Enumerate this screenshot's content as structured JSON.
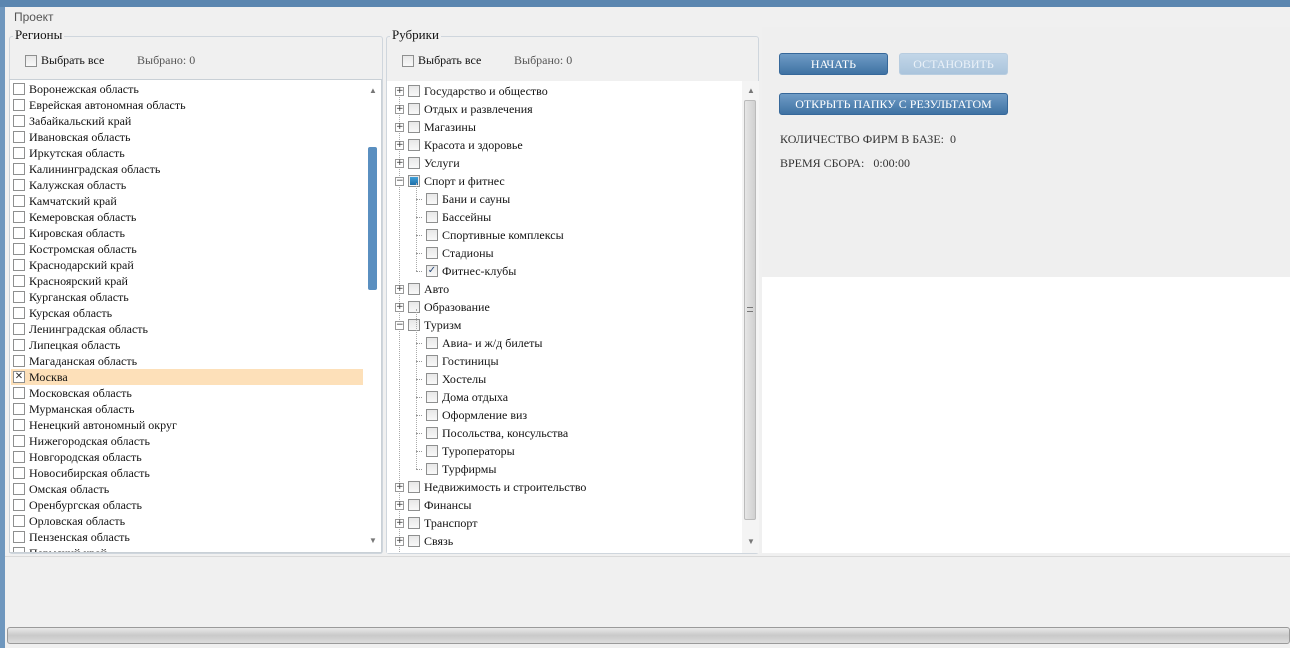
{
  "menu": {
    "project": "Проект"
  },
  "regions": {
    "title": "Регионы",
    "select_all": "Выбрать все",
    "selected": "Выбрано: 0",
    "items": [
      {
        "label": "Воронежская область",
        "checked": false
      },
      {
        "label": "Еврейская автономная область",
        "checked": false
      },
      {
        "label": "Забайкальский край",
        "checked": false
      },
      {
        "label": "Ивановская область",
        "checked": false
      },
      {
        "label": "Иркутская область",
        "checked": false
      },
      {
        "label": "Калининградская область",
        "checked": false
      },
      {
        "label": "Калужская область",
        "checked": false
      },
      {
        "label": "Камчатский край",
        "checked": false
      },
      {
        "label": "Кемеровская область",
        "checked": false
      },
      {
        "label": "Кировская область",
        "checked": false
      },
      {
        "label": "Костромская область",
        "checked": false
      },
      {
        "label": "Краснодарский край",
        "checked": false
      },
      {
        "label": "Красноярский край",
        "checked": false
      },
      {
        "label": "Курганская область",
        "checked": false
      },
      {
        "label": "Курская область",
        "checked": false
      },
      {
        "label": "Ленинградская область",
        "checked": false
      },
      {
        "label": "Липецкая область",
        "checked": false
      },
      {
        "label": "Магаданская область",
        "checked": false
      },
      {
        "label": "Москва",
        "checked": true,
        "selected": true
      },
      {
        "label": "Московская область",
        "checked": false
      },
      {
        "label": "Мурманская область",
        "checked": false
      },
      {
        "label": "Ненецкий автономный округ",
        "checked": false
      },
      {
        "label": "Нижегородская область",
        "checked": false
      },
      {
        "label": "Новгородская область",
        "checked": false
      },
      {
        "label": "Новосибирская область",
        "checked": false
      },
      {
        "label": "Омская область",
        "checked": false
      },
      {
        "label": "Оренбургская область",
        "checked": false
      },
      {
        "label": "Орловская область",
        "checked": false
      },
      {
        "label": "Пензенская область",
        "checked": false
      },
      {
        "label": "Пермский край",
        "checked": false
      }
    ]
  },
  "rubrics": {
    "title": "Рубрики",
    "select_all": "Выбрать все",
    "selected": "Выбрано: 0",
    "items": [
      {
        "label": "Государство и общество",
        "level": 0,
        "expand": "+",
        "state": "none"
      },
      {
        "label": "Отдых и развлечения",
        "level": 0,
        "expand": "+",
        "state": "none"
      },
      {
        "label": "Магазины",
        "level": 0,
        "expand": "+",
        "state": "none"
      },
      {
        "label": "Красота и здоровье",
        "level": 0,
        "expand": "+",
        "state": "none"
      },
      {
        "label": "Услуги",
        "level": 0,
        "expand": "+",
        "state": "none"
      },
      {
        "label": "Спорт и фитнес",
        "level": 0,
        "expand": "-",
        "state": "partial"
      },
      {
        "label": "Бани и сауны",
        "level": 1,
        "state": "none"
      },
      {
        "label": "Бассейны",
        "level": 1,
        "state": "none"
      },
      {
        "label": "Спортивные комплексы",
        "level": 1,
        "state": "none"
      },
      {
        "label": "Стадионы",
        "level": 1,
        "state": "none"
      },
      {
        "label": "Фитнес-клубы",
        "level": 1,
        "state": "checked"
      },
      {
        "label": "Авто",
        "level": 0,
        "expand": "+",
        "state": "none"
      },
      {
        "label": "Образование",
        "level": 0,
        "expand": "+",
        "state": "none"
      },
      {
        "label": "Туризм",
        "level": 0,
        "expand": "-",
        "state": "none"
      },
      {
        "label": "Авиа- и ж/д билеты",
        "level": 1,
        "state": "none"
      },
      {
        "label": "Гостиницы",
        "level": 1,
        "state": "none"
      },
      {
        "label": "Хостелы",
        "level": 1,
        "state": "none"
      },
      {
        "label": "Дома отдыха",
        "level": 1,
        "state": "none"
      },
      {
        "label": "Оформление виз",
        "level": 1,
        "state": "none"
      },
      {
        "label": "Посольства, консульства",
        "level": 1,
        "state": "none"
      },
      {
        "label": "Туроператоры",
        "level": 1,
        "state": "none"
      },
      {
        "label": "Турфирмы",
        "level": 1,
        "state": "none"
      },
      {
        "label": "Недвижимость и строительство",
        "level": 0,
        "expand": "+",
        "state": "none"
      },
      {
        "label": "Финансы",
        "level": 0,
        "expand": "+",
        "state": "none"
      },
      {
        "label": "Транспорт",
        "level": 0,
        "expand": "+",
        "state": "none"
      },
      {
        "label": "Связь",
        "level": 0,
        "expand": "+",
        "state": "none"
      }
    ]
  },
  "actions": {
    "start": "НАЧАТЬ",
    "stop": "ОСТАНОВИТЬ",
    "open_folder": "ОТКРЫТЬ ПАПКУ С РЕЗУЛЬТАТОМ"
  },
  "stats": {
    "firms_label": "КОЛИЧЕСТВО ФИРМ В БАЗЕ:",
    "firms_value": "0",
    "time_label": "ВРЕМЯ СБОРА:",
    "time_value": "0:00:00"
  },
  "progress": {
    "percent": 0
  }
}
